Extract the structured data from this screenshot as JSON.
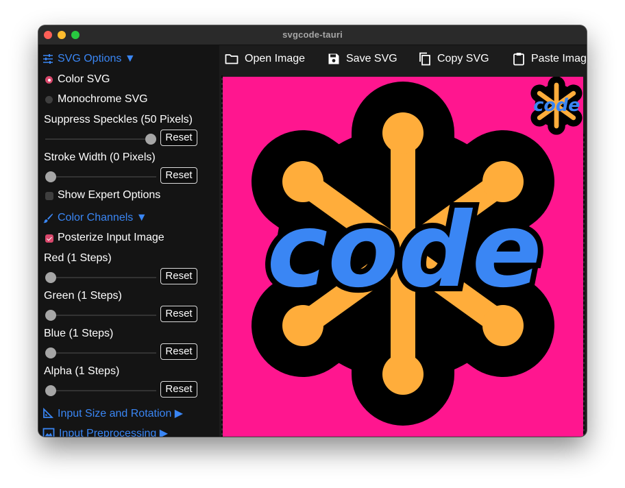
{
  "window": {
    "title": "svgcode-tauri"
  },
  "toolbar": {
    "open": "Open Image",
    "save": "Save SVG",
    "copy": "Copy SVG",
    "paste": "Paste Image"
  },
  "sidebar": {
    "svg_options": "SVG Options ▼",
    "color_svg": "Color SVG",
    "mono_svg": "Monochrome SVG",
    "speckles": "Suppress Speckles (50 Pixels)",
    "speckles_value": 1.0,
    "stroke": "Stroke Width (0 Pixels)",
    "stroke_value": 0.0,
    "expert": "Show Expert Options",
    "color_channels": "Color Channels ▼",
    "posterize": "Posterize Input Image",
    "red": "Red (1 Steps)",
    "green": "Green (1 Steps)",
    "blue": "Blue (1 Steps)",
    "alpha": "Alpha (1 Steps)",
    "reset": "Reset",
    "input_size": "Input Size and Rotation ▶",
    "input_pre": "Input Preprocessing ▶"
  },
  "canvas": {
    "logo_text": "code",
    "background": "#ff168f",
    "accent": "#ffad3b",
    "blue": "#3a86f4"
  }
}
